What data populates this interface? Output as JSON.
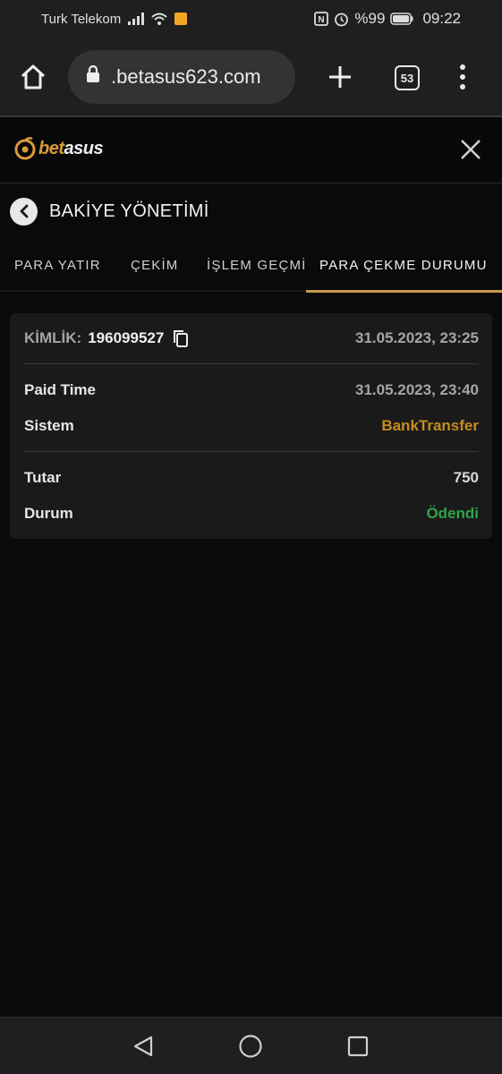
{
  "status_bar": {
    "carrier": "Turk Telekom",
    "battery": "%99",
    "time": "09:22",
    "icons": [
      "signal-icon",
      "wifi-icon",
      "notification-icon",
      "nfc-icon",
      "alarm-icon",
      "battery-icon"
    ]
  },
  "browser": {
    "url": ".betasus623.com",
    "tab_count": "53",
    "icons": [
      "home-icon",
      "lock-icon",
      "plus-icon",
      "more-vert-icon"
    ]
  },
  "site": {
    "logo_gold": "bet",
    "logo_white": "asus",
    "brand_color": "#c99a49"
  },
  "page": {
    "title": "BAKİYE YÖNETİMİ"
  },
  "tabs": [
    {
      "label": "PARA YATIR"
    },
    {
      "label": "ÇEKİM"
    },
    {
      "label": "İŞLEM GEÇMİ"
    },
    {
      "label": "PARA ÇEKME DURUMU",
      "active": true
    }
  ],
  "withdrawal": {
    "id_label": "KİMLİK:",
    "id_value": "196099527",
    "created_at": "31.05.2023, 23:25",
    "paid_time_label": "Paid Time",
    "paid_time_value": "31.05.2023, 23:40",
    "system_label": "Sistem",
    "system_value": "BankTransfer",
    "amount_label": "Tutar",
    "amount_value": "750",
    "status_label": "Durum",
    "status_value": "Ödendi",
    "status_color": "#2fa34a",
    "system_color": "#c78c1f"
  }
}
